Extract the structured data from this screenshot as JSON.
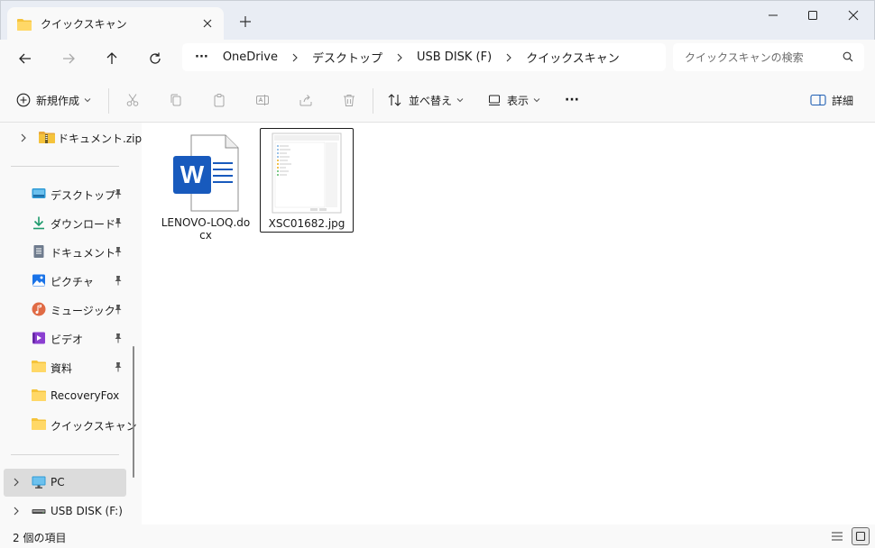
{
  "window": {
    "tab_title": "クイックスキャン",
    "new_tab_label": "+"
  },
  "address": {
    "breadcrumbs": [
      "OneDrive",
      "デスクトップ",
      "USB DISK (F)",
      "クイックスキャン"
    ],
    "more_label": "···",
    "search_placeholder": "クイックスキャンの検索"
  },
  "toolbar": {
    "new_label": "新規作成",
    "sort_label": "並べ替え",
    "view_label": "表示",
    "more_label": "···",
    "details_label": "詳細"
  },
  "sidebar": {
    "top_item": "ドキュメント.zip",
    "quick_access": [
      {
        "label": "デスクトップ",
        "icon": "desktop-icon",
        "pinned": true
      },
      {
        "label": "ダウンロード",
        "icon": "download-icon",
        "pinned": true
      },
      {
        "label": "ドキュメント",
        "icon": "document-icon",
        "pinned": true
      },
      {
        "label": "ピクチャ",
        "icon": "pictures-icon",
        "pinned": true
      },
      {
        "label": "ミュージック",
        "icon": "music-icon",
        "pinned": true
      },
      {
        "label": "ビデオ",
        "icon": "video-icon",
        "pinned": true
      },
      {
        "label": "資料",
        "icon": "folder-icon",
        "pinned": true
      },
      {
        "label": "RecoveryFox",
        "icon": "folder-icon",
        "pinned": false
      },
      {
        "label": "クイックスキャン",
        "icon": "folder-icon",
        "pinned": false
      }
    ],
    "pc_label": "PC",
    "usb_label": "USB DISK (F:)"
  },
  "files": [
    {
      "name": "LENOVO-LOQ.docx",
      "type": "word-document",
      "selected": false
    },
    {
      "name": "XSC01682.jpg",
      "type": "image",
      "selected": true
    }
  ],
  "status": {
    "item_count": "2 個の項目"
  },
  "colors": {
    "folder": "#f5c33b",
    "word_blue": "#185abd",
    "selection_gray": "#dcdcdc"
  }
}
